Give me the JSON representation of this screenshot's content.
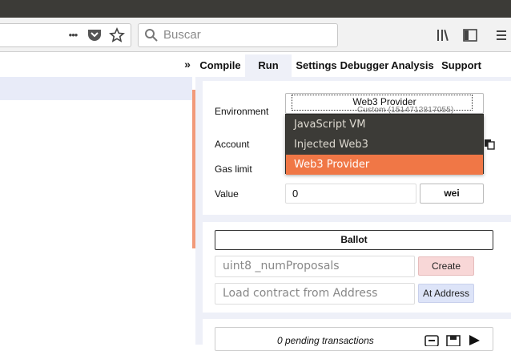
{
  "browser": {
    "search_placeholder": "Buscar",
    "overflow_glyph": "•••",
    "icons": [
      "page-actions-icon",
      "pocket-icon",
      "bookmark-star-icon",
      "search-icon",
      "library-icon",
      "sidebar-icon",
      "hamburger-menu-icon"
    ]
  },
  "header": {
    "collapse_glyph": "»",
    "tabs": [
      {
        "label": "Compile",
        "active": false
      },
      {
        "label": "Run",
        "active": true
      },
      {
        "label": "Settings",
        "active": false
      },
      {
        "label": "Debugger",
        "active": false
      },
      {
        "label": "Analysis",
        "active": false
      },
      {
        "label": "Support",
        "active": false
      }
    ]
  },
  "run": {
    "environment_label": "Environment",
    "environment_value": "Web3 Provider",
    "environment_custom": "Custom (1514712817055)",
    "account_label": "Account",
    "gas_limit_label": "Gas limit",
    "value_label": "Value",
    "value": "0",
    "unit": "wei"
  },
  "dropdown": {
    "options": [
      {
        "label": "JavaScript VM",
        "selected": false
      },
      {
        "label": "Injected Web3",
        "selected": false
      },
      {
        "label": "Web3 Provider",
        "selected": true
      }
    ],
    "highlight_color": "#f07746"
  },
  "contract": {
    "name": "Ballot",
    "constructor_placeholder": "uint8 _numProposals",
    "create_label": "Create",
    "address_placeholder": "Load contract from Address",
    "at_address_label": "At Address"
  },
  "transactions": {
    "pending_text": "0 pending transactions"
  },
  "colors": {
    "accent": "#f29a7a",
    "create_bg": "#f8d7d7",
    "at_address_bg": "#dde4f8"
  }
}
